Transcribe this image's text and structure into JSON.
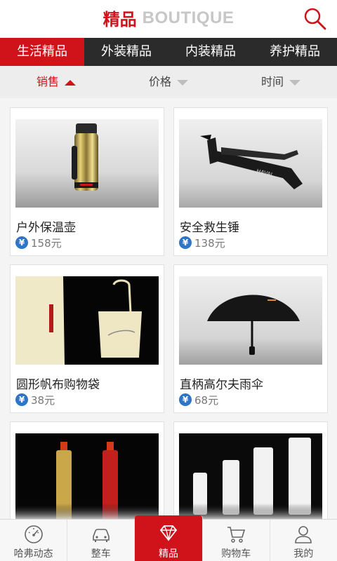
{
  "header": {
    "title_cn": "精品",
    "title_en": "BOUTIQUE",
    "search_icon": "search-icon"
  },
  "tabs": [
    {
      "label": "生活精品",
      "active": true
    },
    {
      "label": "外装精品",
      "active": false
    },
    {
      "label": "内装精品",
      "active": false
    },
    {
      "label": "养护精品",
      "active": false
    }
  ],
  "sort": [
    {
      "label": "销售",
      "arrow": "up",
      "active": true
    },
    {
      "label": "价格",
      "arrow": "down",
      "active": false
    },
    {
      "label": "时间",
      "arrow": "down",
      "active": false
    }
  ],
  "products": [
    {
      "name": "户外保温壶",
      "price": "158元",
      "image": "thermos-image"
    },
    {
      "name": "安全救生锤",
      "price": "138元",
      "image": "rescue-hammer-image"
    },
    {
      "name": "圆形帆布购物袋",
      "price": "38元",
      "image": "canvas-bag-image"
    },
    {
      "name": "直柄高尔夫雨伞",
      "price": "68元",
      "image": "golf-umbrella-image"
    },
    {
      "name": "",
      "price": "",
      "image": "sport-bottles-image"
    },
    {
      "name": "",
      "price": "",
      "image": "white-bottles-image"
    }
  ],
  "currency_symbol": "¥",
  "nav": [
    {
      "label": "哈弗动态",
      "icon": "dashboard-icon",
      "active": false
    },
    {
      "label": "整车",
      "icon": "car-icon",
      "active": false
    },
    {
      "label": "精品",
      "icon": "diamond-icon",
      "active": true
    },
    {
      "label": "购物车",
      "icon": "cart-icon",
      "active": false
    },
    {
      "label": "我的",
      "icon": "user-icon",
      "active": false
    }
  ],
  "colors": {
    "brand_red": "#d0121b",
    "tab_bar": "#2b2b2b",
    "price_badge": "#2e74c8"
  }
}
